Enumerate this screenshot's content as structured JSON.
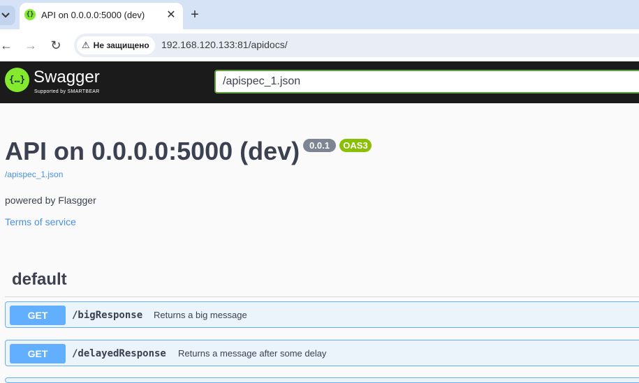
{
  "browser": {
    "tab_title": "API on 0.0.0.0:5000 (dev)",
    "tab_close": "✕",
    "new_tab": "+",
    "back": "←",
    "forward": "→",
    "reload": "↻",
    "security_label": "Не защищено",
    "warn_icon": "⚠",
    "url": "192.168.120.133:81/apidocs/"
  },
  "topbar": {
    "logo_icon": "{…}",
    "logo_text": "Swagger",
    "logo_sub": "Supported by SMARTBEAR",
    "spec_url": "/apispec_1.json"
  },
  "info": {
    "title": "API on 0.0.0.0:5000 (dev)",
    "version": "0.0.1",
    "oas": "OAS3",
    "spec_link": "/apispec_1.json",
    "description": "powered by Flasgger",
    "terms": "Terms of service"
  },
  "tag": {
    "name": "default"
  },
  "operations": [
    {
      "method": "GET",
      "path": "/bigResponse",
      "summary": "Returns a big message"
    },
    {
      "method": "GET",
      "path": "/delayedResponse",
      "summary": "Returns a message after some delay"
    }
  ],
  "colors": {
    "get": "#61affe",
    "swagger_green": "#85ea2d",
    "oas_badge": "#89bf04",
    "topbar": "#1b1b1b"
  }
}
